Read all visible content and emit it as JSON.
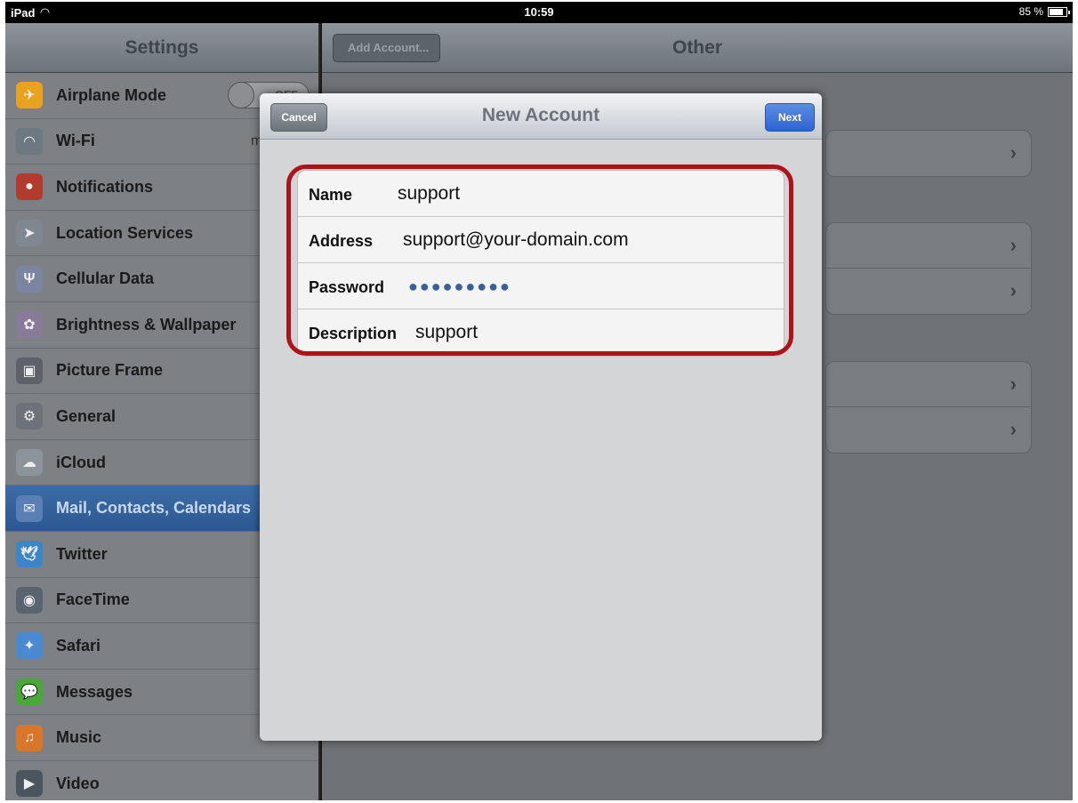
{
  "status_bar": {
    "device": "iPad",
    "time": "10:59",
    "battery": "85 %",
    "battery_fraction": 0.85
  },
  "master": {
    "title": "Settings",
    "airplane_toggle": "OFF",
    "wifi_value": "m",
    "items": [
      {
        "label": "Airplane Mode",
        "icon": "airplane-icon",
        "color": "#e8a21d",
        "glyph": "✈"
      },
      {
        "label": "Wi-Fi",
        "icon": "wifi-icon",
        "color": "#6d7880",
        "glyph": "◠"
      },
      {
        "label": "Notifications",
        "icon": "notifications-icon",
        "color": "#b23b2e",
        "glyph": "●"
      },
      {
        "label": "Location Services",
        "icon": "location-arrow-icon",
        "color": "#7f8790",
        "glyph": "➤"
      },
      {
        "label": "Cellular Data",
        "icon": "cellular-antenna-icon",
        "color": "#7c85a0",
        "glyph": "Ψ"
      },
      {
        "label": "Brightness & Wallpaper",
        "icon": "flower-icon",
        "color": "#8a7a9a",
        "glyph": "✿"
      },
      {
        "label": "Picture Frame",
        "icon": "picture-frame-icon",
        "color": "#5d6268",
        "glyph": "▣"
      },
      {
        "label": "General",
        "icon": "gear-icon",
        "color": "#6c7278",
        "glyph": "⚙"
      },
      {
        "label": "iCloud",
        "icon": "cloud-icon",
        "color": "#8c939a",
        "glyph": "☁"
      },
      {
        "label": "Mail, Contacts, Calendars",
        "icon": "mail-icon",
        "color": "#5a7fb5",
        "glyph": "✉"
      },
      {
        "label": "Twitter",
        "icon": "twitter-bird-icon",
        "color": "#3d86c6",
        "glyph": "🕊"
      },
      {
        "label": "FaceTime",
        "icon": "facetime-camera-icon",
        "color": "#5a6470",
        "glyph": "◉"
      },
      {
        "label": "Safari",
        "icon": "compass-icon",
        "color": "#4a8ad0",
        "glyph": "✦"
      },
      {
        "label": "Messages",
        "icon": "speech-bubble-icon",
        "color": "#4aa83a",
        "glyph": "💬"
      },
      {
        "label": "Music",
        "icon": "music-note-icon",
        "color": "#d8762a",
        "glyph": "♫"
      },
      {
        "label": "Video",
        "icon": "video-icon",
        "color": "#4b5560",
        "glyph": "▶"
      }
    ],
    "selected_index": 9
  },
  "detail": {
    "back_label": "Add Account...",
    "title": "Other"
  },
  "modal": {
    "title": "New Account",
    "cancel_label": "Cancel",
    "next_label": "Next",
    "fields": [
      {
        "label": "Name",
        "value": "support"
      },
      {
        "label": "Address",
        "value": "support@your-domain.com"
      },
      {
        "label": "Password",
        "value": "●●●●●●●●●"
      },
      {
        "label": "Description",
        "value": "support"
      }
    ]
  },
  "colors": {
    "highlight": "#b0121a",
    "next_button": "#2d63d2",
    "selected_row": "#2c5890"
  }
}
